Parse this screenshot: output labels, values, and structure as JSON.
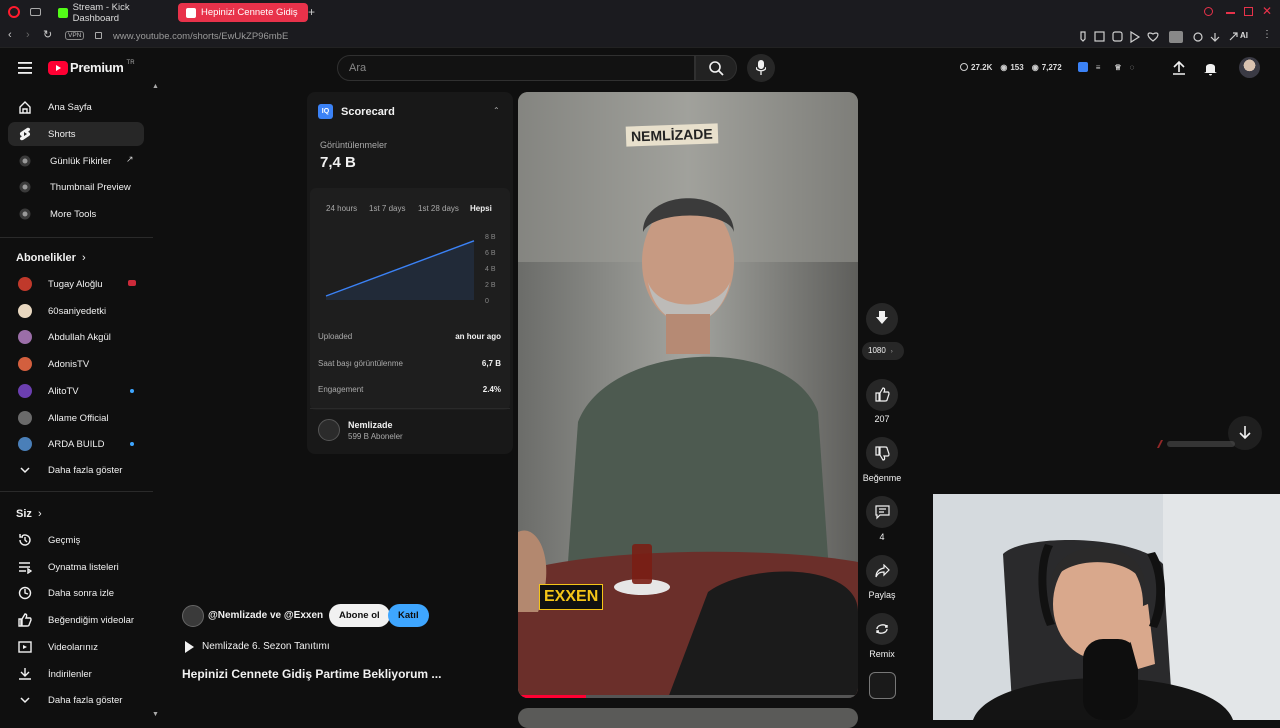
{
  "browser": {
    "tabs": [
      {
        "label": "Stream - Kick Dashboard",
        "fav_color": "#53fc18"
      },
      {
        "label": "Hepinizi Cennete Gidiş",
        "fav_color": "#ff0033",
        "active": true
      }
    ],
    "url": "www.youtube.com/shorts/EwUkZP96mbE",
    "vpn_label": "VPN",
    "ext_stats": {
      "time": "27.2K",
      "views": "153",
      "views2": "7,272"
    },
    "ai_label": "AI"
  },
  "header": {
    "logo_text": "Premium",
    "logo_region": "TR",
    "search_placeholder": "Ara"
  },
  "sidebar": {
    "main": [
      {
        "label": "Ana Sayfa",
        "icon": "home-icon"
      },
      {
        "label": "Shorts",
        "icon": "shorts-icon",
        "active": true
      },
      {
        "label": "Günlük Fikirler",
        "icon": "tool-icon",
        "external": true
      },
      {
        "label": "Thumbnail Preview",
        "icon": "tool-icon"
      },
      {
        "label": "More Tools",
        "icon": "tool-icon"
      }
    ],
    "subs_title": "Abonelikler",
    "subs": [
      {
        "label": "Tugay Aloğlu",
        "color": "#c0392b",
        "live": true
      },
      {
        "label": "60saniyedetki",
        "color": "#e8d7c0"
      },
      {
        "label": "Abdullah Akgül",
        "color": "#9b6ea8"
      },
      {
        "label": "AdonisTV",
        "color": "#d35f3e"
      },
      {
        "label": "AlitoTV",
        "color": "#6b3fb0",
        "dot": true
      },
      {
        "label": "Allame Official",
        "color": "#6a6a6a"
      },
      {
        "label": "ARDA BUILD",
        "color": "#4a7fb8",
        "dot": true
      }
    ],
    "show_more": "Daha fazla göster",
    "you_title": "Siz",
    "you": [
      {
        "label": "Geçmiş",
        "icon": "history-icon"
      },
      {
        "label": "Oynatma listeleri",
        "icon": "playlist-icon"
      },
      {
        "label": "Daha sonra izle",
        "icon": "clock-icon"
      },
      {
        "label": "Beğendiğim videolar",
        "icon": "like-icon"
      },
      {
        "label": "Videolarınız",
        "icon": "video-icon"
      },
      {
        "label": "İndirilenler",
        "icon": "download-icon"
      }
    ],
    "show_more2": "Daha fazla göster"
  },
  "scorecard": {
    "title": "Scorecard",
    "views_label": "Görüntülenmeler",
    "views_value": "7,4 B",
    "ranges": [
      "24 hours",
      "1st 7 days",
      "1st 28 days",
      "Hepsi"
    ],
    "active_range": "Hepsi",
    "stats": [
      {
        "label": "Uploaded",
        "value": "an hour ago"
      },
      {
        "label": "Saat başı görüntülenme",
        "value": "6,7 B"
      },
      {
        "label": "Engagement",
        "value": "2.4%"
      }
    ],
    "channel_name": "Nemlizade",
    "channel_subs": "599 B Aboneler"
  },
  "chart_data": {
    "type": "line",
    "y_ticks": [
      "8 B",
      "6 B",
      "4 B",
      "2 B",
      "0"
    ],
    "ylim": [
      0,
      8
    ],
    "series": [
      {
        "values": [
          0.5,
          7.4
        ]
      }
    ],
    "color": "#3b82f6"
  },
  "video": {
    "overlay_title": "NEMLİZADE",
    "brand": "EXXEN",
    "channel_line": "@Nemlizade ve @Exxen",
    "subscribe": "Abone ol",
    "join": "Katıl",
    "playlist": "Nemlizade 6. Sezon Tanıtımı",
    "title": "Hepinizi Cennete Gidiş Partime Bekliyorum ...",
    "progress": 0.2
  },
  "actions": {
    "quality": "1080",
    "likes": "207",
    "dislike": "Beğenme",
    "comments": "4",
    "share": "Paylaş",
    "remix": "Remix"
  }
}
